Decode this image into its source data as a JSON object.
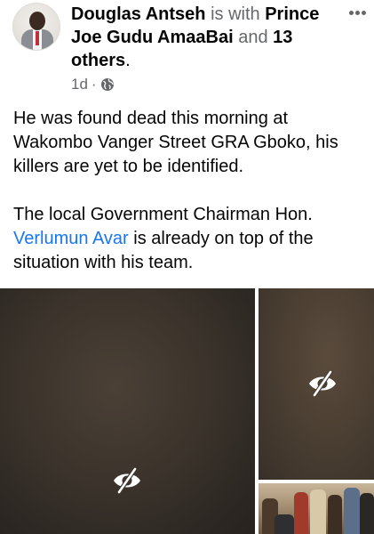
{
  "post": {
    "author": "Douglas Antseh",
    "with_word": "is with",
    "tagged_name": "Prince Joe Gudu AmaaBai",
    "and_word": "and",
    "others": "13 others",
    "period": ".",
    "time": "1d",
    "separator": "·",
    "audience_icon": "globe-icon",
    "paragraph1": "He was found dead this morning at Wakombo Vanger Street GRA Gboko, his killers are yet to be identified.",
    "paragraph2_before": "The local Government Chairman Hon. ",
    "paragraph2_link": "Verlumun Avar",
    "paragraph2_after": " is already on top of the situation with his team."
  },
  "photos": {
    "hidden_icon": "eye-slash-icon",
    "count": 3
  },
  "colors": {
    "text": "#050505",
    "muted": "#65676b",
    "link": "#1876f2"
  }
}
